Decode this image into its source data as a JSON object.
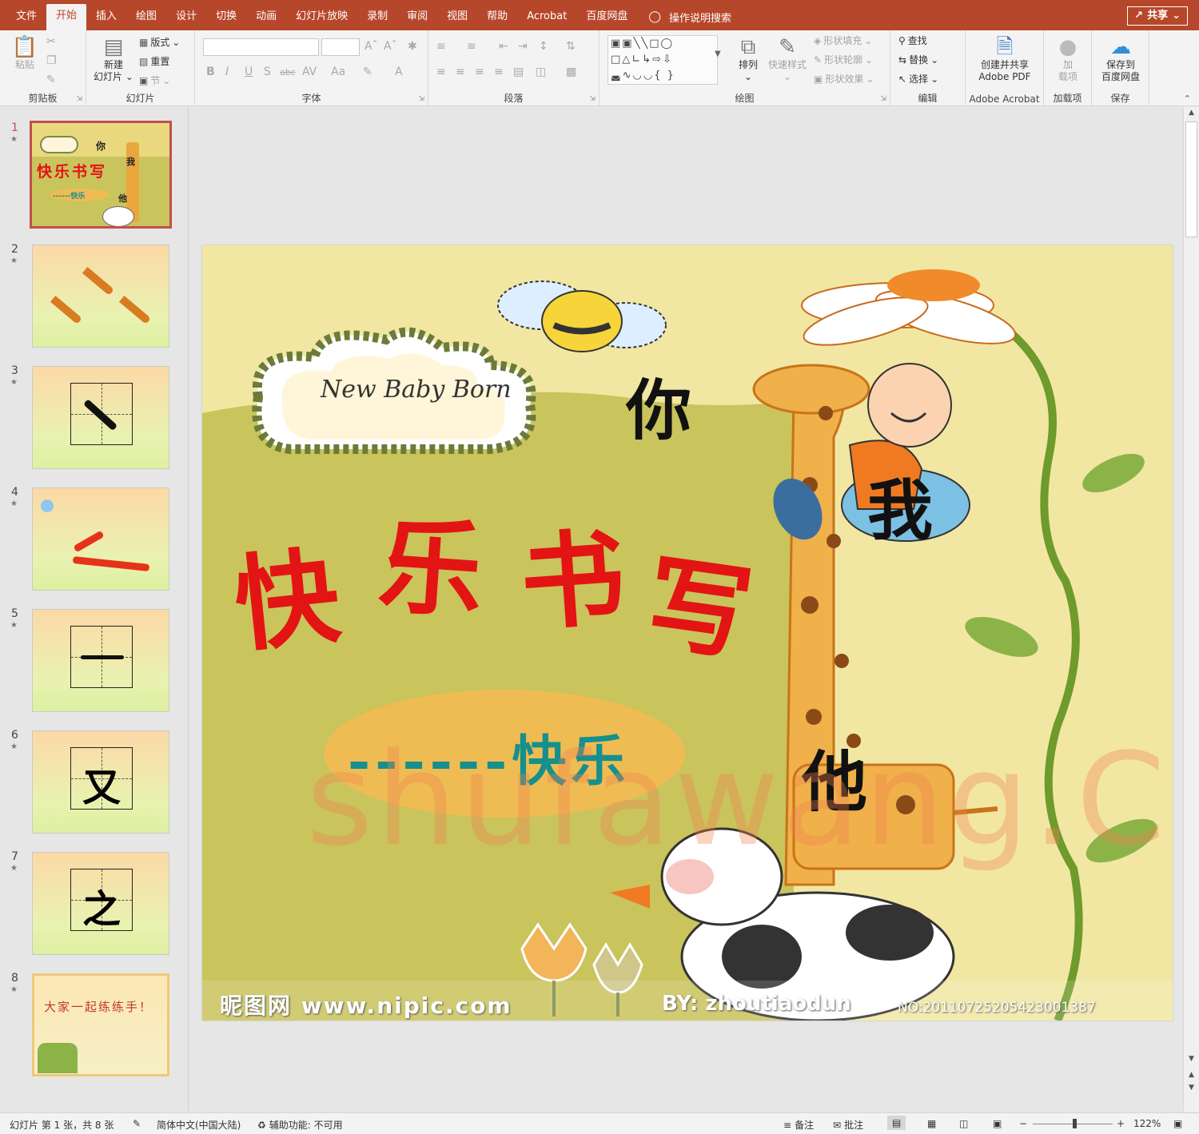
{
  "tabs": [
    {
      "label": "文件",
      "active": false
    },
    {
      "label": "开始",
      "active": true
    },
    {
      "label": "插入",
      "active": false
    },
    {
      "label": "绘图",
      "active": false
    },
    {
      "label": "设计",
      "active": false
    },
    {
      "label": "切换",
      "active": false
    },
    {
      "label": "动画",
      "active": false
    },
    {
      "label": "幻灯片放映",
      "active": false
    },
    {
      "label": "录制",
      "active": false
    },
    {
      "label": "审阅",
      "active": false
    },
    {
      "label": "视图",
      "active": false
    },
    {
      "label": "帮助",
      "active": false
    },
    {
      "label": "Acrobat",
      "active": false
    },
    {
      "label": "百度网盘",
      "active": false
    }
  ],
  "tell_me": "操作说明搜索",
  "share_label": "共享",
  "ribbon": {
    "clipboard": {
      "group": "剪贴板",
      "paste": "粘贴"
    },
    "slides": {
      "group": "幻灯片",
      "new_slide": "新建",
      "new_slide_2": "幻灯片",
      "layout": "版式",
      "reset": "重置",
      "section": "节"
    },
    "font": {
      "group": "字体"
    },
    "paragraph": {
      "group": "段落"
    },
    "drawing": {
      "group": "绘图",
      "arrange": "排列",
      "quick_styles": "快速样式",
      "shape_fill": "形状填充",
      "shape_outline": "形状轮廓",
      "shape_effects": "形状效果"
    },
    "editing": {
      "group": "编辑",
      "find": "查找",
      "replace": "替换",
      "select": "选择"
    },
    "acrobat": {
      "group": "Adobe Acrobat",
      "create_pdf": "创建并共享",
      "create_pdf_2": "Adobe PDF"
    },
    "addins": {
      "group": "加载项",
      "addins": "加",
      "addins_2": "载项"
    },
    "save": {
      "group": "保存",
      "save_to": "保存到",
      "save_to_2": "百度网盘"
    }
  },
  "thumbnails": [
    {
      "num": "1",
      "selected": true,
      "chars": [
        "快",
        "乐",
        "书",
        "写"
      ],
      "extra": "你",
      "extra2": "我",
      "extra3": "他",
      "sub": "------快乐"
    },
    {
      "num": "2",
      "selected": false
    },
    {
      "num": "3",
      "selected": false
    },
    {
      "num": "4",
      "selected": false
    },
    {
      "num": "5",
      "selected": false
    },
    {
      "num": "6",
      "selected": false,
      "char": "又"
    },
    {
      "num": "7",
      "selected": false,
      "char": "之"
    },
    {
      "num": "8",
      "selected": false,
      "text": "大家一起练练手！"
    }
  ],
  "slide": {
    "sign": "New Baby Born",
    "title_chars": [
      "快",
      "乐",
      "书",
      "写"
    ],
    "word_ni": "你",
    "word_wo": "我",
    "word_ta": "他",
    "subtitle": "------快乐",
    "footer_left": "昵图网 www.nipic.com",
    "footer_by": "BY: zhoutiaodun",
    "footer_no": "NO:20110725205423001387",
    "watermark": "shufawang.CN",
    "colors": {
      "title": "#e31414",
      "subtitle": "#178f8d",
      "bg": "#f1e7a3",
      "hill": "#c9c45c",
      "oval": "#eebc53"
    }
  },
  "status": {
    "slide_info": "幻灯片 第 1 张，共 8 张",
    "language": "简体中文(中国大陆)",
    "accessibility": "辅助功能: 不可用",
    "notes": "备注",
    "comments": "批注",
    "zoom": "122%"
  }
}
